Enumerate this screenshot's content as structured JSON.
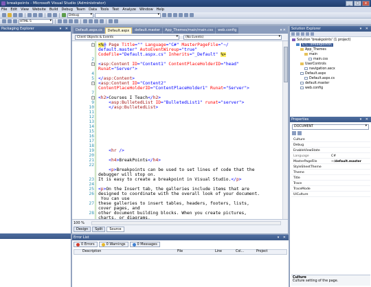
{
  "window": {
    "title": "breakpoints - Microsoft Visual Studio (Administrator)"
  },
  "menu": [
    "File",
    "Edit",
    "View",
    "Website",
    "Build",
    "Debug",
    "Team",
    "Data",
    "Tools",
    "Test",
    "Analyze",
    "Window",
    "Help"
  ],
  "toolbar": {
    "config_combo": "Debug",
    "html_combo": "HTML 5"
  },
  "left_panel": {
    "title": "Packaging Explorer"
  },
  "editor": {
    "tabs": [
      "Default.aspx.cs",
      "Default.aspx",
      "default.master",
      "App_Themes/main/main.css",
      "web.config"
    ],
    "active_tab": "Default.aspx",
    "nav_left": "Client Objects & Events",
    "nav_right": "(No Events)",
    "zoom": "100 %",
    "view_tabs": [
      "Design",
      "Split",
      "Source"
    ],
    "active_view": "Source"
  },
  "code_lines": [
    {
      "n": "1",
      "y": 0,
      "html": "<span class='hl'>&lt;%</span><span class='bl'>@ </span><span class='r'>Page</span> <span class='k'>Title</span>=<span class='bl'>\"\"</span> <span class='k'>Language</span>=<span class='bl'>\"C#\"</span> <span class='k'>MasterPageFile</span>=<span class='bl'>\"~/</span>"
    },
    {
      "n": "",
      "y": 1,
      "html": "<span class='bl'>default.master\"</span> <span class='k'>AutoEventWireup</span>=<span class='bl'>\"true\"</span>"
    },
    {
      "n": "",
      "y": 2,
      "html": "<span class='k'>CodeFile</span>=<span class='bl'>\"Default.aspx.cs\"</span> <span class='k'>Inherits</span>=<span class='bl'>\"_Default\"</span> <span class='hl'>%&gt;</span>"
    },
    {
      "n": "2",
      "y": 3,
      "html": ""
    },
    {
      "n": "3",
      "y": 4,
      "html": "&lt;<span class='r'>asp:Content</span> <span class='k'>ID</span>=<span class='bl'>\"Content1\"</span> <span class='k'>ContentPlaceHolderID</span>=<span class='bl'>\"head\"</span>"
    },
    {
      "n": "",
      "y": 5,
      "html": "<span class='k'>Runat</span>=<span class='bl'>\"Server\"</span>&gt;"
    },
    {
      "n": "4",
      "y": 6,
      "html": ""
    },
    {
      "n": "5",
      "y": 7,
      "html": "&lt;/<span class='r'>asp:Content</span>&gt;"
    },
    {
      "n": "6",
      "y": 8,
      "html": "&lt;<span class='r'>asp:Content</span> <span class='k'>ID</span>=<span class='bl'>\"Content2\"</span>"
    },
    {
      "n": "",
      "y": 9,
      "html": "<span class='k'>ContentPlaceHolderID</span>=<span class='bl'>\"ContentPlaceHolder1\"</span> <span class='k'>Runat</span>=<span class='bl'>\"Server\"</span>&gt;"
    },
    {
      "n": "7",
      "y": 10,
      "html": ""
    },
    {
      "n": "8",
      "y": 11,
      "html": "&lt;<span class='r'>h2</span>&gt;<span class='tx'>Courses I Teach</span>&lt;/<span class='r'>h2</span>&gt;"
    },
    {
      "n": "9",
      "y": 12,
      "html": "    &lt;<span class='r'>asp:BulletedList</span> <span class='k'>ID</span>=<span class='bl'>\"BulletedList1\"</span> <span class='k'>runat</span>=<span class='bl'>\"server\"</span>&gt;"
    },
    {
      "n": "10",
      "y": 13,
      "html": "    &lt;/<span class='r'>asp:BulletedList</span>&gt;"
    },
    {
      "n": "11",
      "y": 14,
      "html": ""
    },
    {
      "n": "12",
      "y": 15,
      "html": ""
    },
    {
      "n": "13",
      "y": 16,
      "html": ""
    },
    {
      "n": "14",
      "y": 17,
      "html": ""
    },
    {
      "n": "15",
      "y": 18,
      "html": ""
    },
    {
      "n": "16",
      "y": 19,
      "html": ""
    },
    {
      "n": "17",
      "y": 20,
      "html": ""
    },
    {
      "n": "18",
      "y": 21,
      "html": ""
    },
    {
      "n": "19",
      "y": 22,
      "html": "    &lt;<span class='r'>hr</span> /&gt;"
    },
    {
      "n": "20",
      "y": 23,
      "html": ""
    },
    {
      "n": "21",
      "y": 24,
      "html": "    &lt;<span class='r'>h4</span>&gt;<span class='tx'>BreakPoints</span>&lt;/<span class='r'>h4</span>&gt;"
    },
    {
      "n": "22",
      "y": 25,
      "html": ""
    },
    {
      "n": "",
      "y": 26,
      "html": "    &lt;<span class='r'>p</span>&gt;<span class='tx'>Breakpoints can be used to set lines of code that the</span>"
    },
    {
      "n": "",
      "y": 27,
      "html": "<span class='tx'>debugger will stop on.</span>"
    },
    {
      "n": "23",
      "y": 28,
      "html": "<span class='tx'>It is easy to create a breakpoint in Visual Studio.</span>&lt;/<span class='r'>p</span>&gt;"
    },
    {
      "n": "24",
      "y": 29,
      "html": ""
    },
    {
      "n": "25",
      "y": 30,
      "html": "&lt;<span class='r'>p</span>&gt;<span class='tx'>On the Insert tab, the galleries include items that are</span>"
    },
    {
      "n": "26",
      "y": 31,
      "html": "<span class='tx'>designed to coordinate with the overall look of your document.</span>"
    },
    {
      "n": "",
      "y": 32,
      "html": "<span class='tx'> You can use</span>"
    },
    {
      "n": "27",
      "y": 33,
      "html": "<span class='tx'>these galleries to insert tables, headers, footers, lists,</span>"
    },
    {
      "n": "",
      "y": 34,
      "html": "<span class='tx'>cover pages, and</span>"
    },
    {
      "n": "28",
      "y": 35,
      "html": "<span class='tx'>other document building blocks. When you create pictures,</span>"
    },
    {
      "n": "",
      "y": 36,
      "html": "<span class='tx'>charts, or diagrams,</span>"
    }
  ],
  "solution_explorer": {
    "title": "Solution Explorer",
    "items": [
      {
        "label": "Solution 'breakpoints' (1 project)",
        "indent": 0,
        "icon": "sol"
      },
      {
        "label": "C:\\...\\breakpoints\\",
        "indent": 1,
        "icon": "web",
        "selected": true
      },
      {
        "label": "App_Themes",
        "indent": 2,
        "icon": "folder"
      },
      {
        "label": "main",
        "indent": 3,
        "icon": "folder"
      },
      {
        "label": "main.css",
        "indent": 4,
        "icon": "file"
      },
      {
        "label": "UserControls",
        "indent": 2,
        "icon": "folder"
      },
      {
        "label": "navigation.ascx",
        "indent": 3,
        "icon": "file"
      },
      {
        "label": "Default.aspx",
        "indent": 2,
        "icon": "file"
      },
      {
        "label": "Default.aspx.cs",
        "indent": 3,
        "icon": "file"
      },
      {
        "label": "default.master",
        "indent": 2,
        "icon": "file"
      },
      {
        "label": "web.config",
        "indent": 2,
        "icon": "file"
      }
    ]
  },
  "properties": {
    "title": "Properties",
    "object": "DOCUMENT",
    "rows": [
      {
        "name": "Culture",
        "value": ""
      },
      {
        "name": "Debug",
        "value": ""
      },
      {
        "name": "EnableViewState",
        "value": ""
      },
      {
        "name": "Language",
        "value": "C#",
        "gray": true
      },
      {
        "name": "MasterPageFile",
        "value": "~/default.master",
        "bold": true
      },
      {
        "name": "StyleSheetTheme",
        "value": ""
      },
      {
        "name": "Theme",
        "value": ""
      },
      {
        "name": "Title",
        "value": ""
      },
      {
        "name": "Trace",
        "value": ""
      },
      {
        "name": "TraceMode",
        "value": ""
      },
      {
        "name": "UICulture",
        "value": ""
      }
    ],
    "desc_title": "Culture",
    "desc_text": "Culture setting of the page."
  },
  "error_list": {
    "title": "Error List",
    "errors": "0 Errors",
    "warnings": "0 Warnings",
    "messages": "0 Messages",
    "columns": [
      "Description",
      "File",
      "Line",
      "Col...",
      "Project"
    ]
  },
  "colors": {
    "accent": "#3b5989",
    "highlight": "#ffee62"
  }
}
